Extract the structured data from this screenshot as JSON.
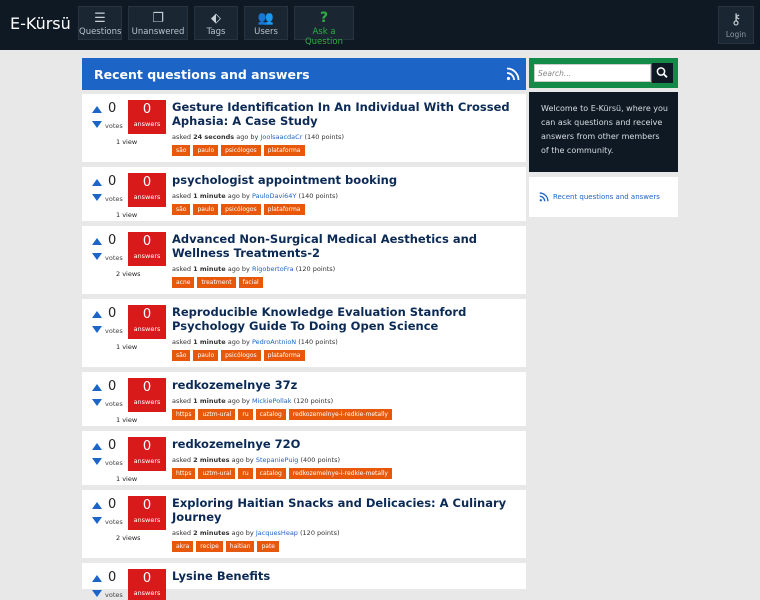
{
  "site": {
    "name": "E-Kürsü"
  },
  "nav": [
    {
      "label": "Questions",
      "icon": "questions-icon"
    },
    {
      "label": "Unanswered",
      "icon": "unanswered-icon"
    },
    {
      "label": "Tags",
      "icon": "tag-icon"
    },
    {
      "label": "Users",
      "icon": "users-icon"
    },
    {
      "label": "Ask a Question",
      "icon": "question-mark-icon"
    }
  ],
  "login": {
    "label": "Login",
    "icon": "key-icon"
  },
  "header": {
    "title": "Recent questions and answers"
  },
  "questions": [
    {
      "votes": "0",
      "votes_label": "votes",
      "answers": "0",
      "answers_label": "answers",
      "views": "1 view",
      "title": "Gesture Identification In An Individual With Crossed Aphasia: A Case Study",
      "asked": "asked",
      "when": "24 seconds",
      "ago": "ago by",
      "user": "JoolsaacdaCr",
      "points": "(140 points)",
      "tags": [
        "são",
        "paulo",
        "psicólogos",
        "plataforma"
      ]
    },
    {
      "votes": "0",
      "votes_label": "votes",
      "answers": "0",
      "answers_label": "answers",
      "views": "1 view",
      "title": "psychologist appointment booking",
      "asked": "asked",
      "when": "1 minute",
      "ago": "ago by",
      "user": "PauloDavi64Y",
      "points": "(140 points)",
      "tags": [
        "são",
        "paulo",
        "psicólogos",
        "plataforma"
      ]
    },
    {
      "votes": "0",
      "votes_label": "votes",
      "answers": "0",
      "answers_label": "answers",
      "views": "2 views",
      "title": "Advanced Non-Surgical Medical Aesthetics and Wellness Treatments-2",
      "asked": "asked",
      "when": "1 minute",
      "ago": "ago by",
      "user": "RigobertoFra",
      "points": "(120 points)",
      "tags": [
        "acne",
        "treatment",
        "facial"
      ]
    },
    {
      "votes": "0",
      "votes_label": "votes",
      "answers": "0",
      "answers_label": "answers",
      "views": "1 view",
      "title": "Reproducible Knowledge Evaluation Stanford Psychology Guide To Doing Open Science",
      "asked": "asked",
      "when": "1 minute",
      "ago": "ago by",
      "user": "PedroAntnioN",
      "points": "(140 points)",
      "tags": [
        "são",
        "paulo",
        "psicólogos",
        "plataforma"
      ]
    },
    {
      "votes": "0",
      "votes_label": "votes",
      "answers": "0",
      "answers_label": "answers",
      "views": "1 view",
      "title": "redkozemelnye 37z",
      "asked": "asked",
      "when": "1 minute",
      "ago": "ago by",
      "user": "MickiePollak",
      "points": "(120 points)",
      "tags": [
        "https",
        "uztm-ural",
        "ru",
        "catalog",
        "redkozemelnye-i-redkie-metally"
      ]
    },
    {
      "votes": "0",
      "votes_label": "votes",
      "answers": "0",
      "answers_label": "answers",
      "views": "1 view",
      "title": "redkozemelnye 72O",
      "asked": "asked",
      "when": "2 minutes",
      "ago": "ago by",
      "user": "StepaniePuig",
      "points": "(400 points)",
      "tags": [
        "https",
        "uztm-ural",
        "ru",
        "catalog",
        "redkozemelnye-i-redkie-metally"
      ]
    },
    {
      "votes": "0",
      "votes_label": "votes",
      "answers": "0",
      "answers_label": "answers",
      "views": "2 views",
      "title": "Exploring Haitian Snacks and Delicacies: A Culinary Journey",
      "asked": "asked",
      "when": "2 minutes",
      "ago": "ago by",
      "user": "JacquesHeap",
      "points": "(120 points)",
      "tags": [
        "akra",
        "recipe",
        "haitian",
        "pate"
      ]
    },
    {
      "votes": "0",
      "votes_label": "votes",
      "answers": "0",
      "answers_label": "answers",
      "views": "",
      "title": "Lysine Benefits",
      "asked": "",
      "when": "",
      "ago": "",
      "user": "",
      "points": "",
      "tags": []
    }
  ],
  "sidebar": {
    "search_placeholder": "Search...",
    "welcome": "Welcome to E-Kürsü, where you can ask questions and receive answers from other members of the community.",
    "feed_link": "Recent questions and answers"
  },
  "colors": {
    "topbar": "#0e1923",
    "accent": "#1c64c6",
    "answers": "#d81a1a",
    "tag": "#e8580b",
    "search": "#138a47",
    "ask": "#2fae44"
  }
}
